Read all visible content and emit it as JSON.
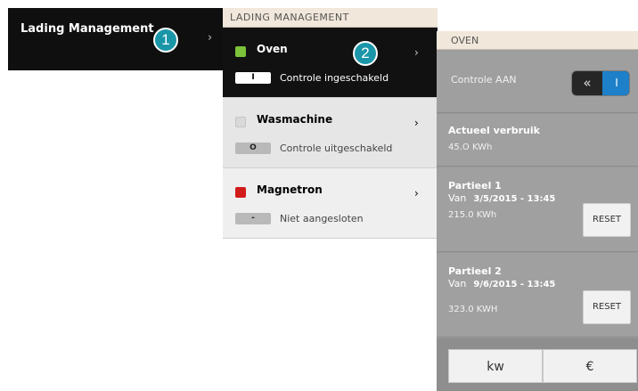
{
  "panel1": {
    "title": "Lading Management",
    "chevron": "›",
    "callout": "1"
  },
  "panel2": {
    "header": "LADING MANAGEMENT",
    "callout": "2",
    "items": [
      {
        "name": "Oven",
        "badge": "I",
        "status": "Controle ingeschakeld",
        "indicator_color": "#7cc23a",
        "chevron": "›"
      },
      {
        "name": "Wasmachine",
        "badge": "O",
        "status": "Controle uitgeschakeld",
        "indicator_color": "#d9d9d9",
        "chevron": "›"
      },
      {
        "name": "Magnetron",
        "badge": "-",
        "status": "Niet aangesloten",
        "indicator_color": "#d21b1b",
        "chevron": "›"
      }
    ]
  },
  "panel3": {
    "header": "OVEN",
    "control_label": "Controle AAN",
    "toggle_left": "«",
    "toggle_right": "I",
    "usage_label": "Actueel verbruik",
    "usage_value": "45.O KWh",
    "partial1": {
      "label": "Partieel 1",
      "van": "Van",
      "date": "3/5/2015 - 13:45",
      "value": "215.0 KWh",
      "reset": "RESET"
    },
    "partial2": {
      "label": "Partieel 2",
      "van": "Van",
      "date": "9/6/2015 - 13:45",
      "value": "323.0 KWH",
      "reset": "RESET"
    },
    "unit_kw": "kw",
    "unit_eur": "€"
  },
  "colors": {
    "accent": "#1a96a8",
    "toggle_on": "#1d80c8"
  }
}
